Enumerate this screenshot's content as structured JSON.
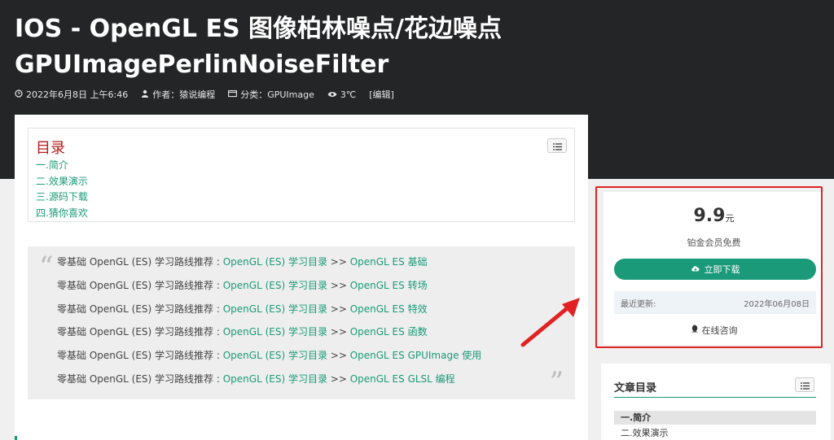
{
  "article": {
    "title_line1": "IOS  -  OpenGL ES 图像柏林噪点/花边噪点",
    "title_line2": "GPUImagePerlinNoiseFilter",
    "meta": {
      "date": "2022年6月8日 上午6:46",
      "author": "作者：猿说编程",
      "category": "分类：GPUImage",
      "views": "3℃",
      "edit": "[编辑]"
    }
  },
  "toc": {
    "title": "目录",
    "items": [
      "一.简介",
      "二.效果演示",
      "三.源码下载",
      "四.猜你喜欢"
    ]
  },
  "quote": {
    "open_mark": "“",
    "close_mark": "”",
    "prefix": "零基础 OpenGL (ES) 学习路线推荐 : ",
    "lines": [
      {
        "link1": "OpenGL (ES) 学习目录",
        "sep": " >> ",
        "link2": "OpenGL ES 基础"
      },
      {
        "link1": "OpenGL (ES) 学习目录",
        "sep": " >> ",
        "link2": "OpenGL ES 转场"
      },
      {
        "link1": "OpenGL (ES) 学习目录",
        "sep": " >> ",
        "link2": "OpenGL ES 特效"
      },
      {
        "link1": "OpenGL (ES) 学习目录",
        "sep": " >> ",
        "link2": "OpenGL ES 函数"
      },
      {
        "link1": "OpenGL (ES) 学习目录",
        "sep": " >> ",
        "link2": "OpenGL ES GPUImage 使用"
      },
      {
        "link1": "OpenGL (ES) 学习目录",
        "sep": " >> ",
        "link2": "OpenGL ES GLSL 编程"
      }
    ]
  },
  "buy": {
    "price": "9.9",
    "unit": "元",
    "free_text": "铂金会员免费",
    "download_label": "立即下载",
    "updated_label": "最近更新:",
    "updated_value": "2022年06月08日",
    "consult_label": "在线咨询"
  },
  "side_toc": {
    "title": "文章目录",
    "items": [
      "一.简介",
      "二.效果演示"
    ]
  },
  "colors": {
    "accent": "#1a9a78",
    "header_bg": "#242526",
    "highlight_red": "#e02222",
    "toc_title": "#b51919"
  },
  "icons": {
    "date": "clock-icon",
    "author": "user-icon",
    "category": "folder-icon",
    "views": "eye-icon",
    "toc_toggle": "list-icon",
    "download": "cloud-download-icon",
    "consult": "qq-icon"
  }
}
